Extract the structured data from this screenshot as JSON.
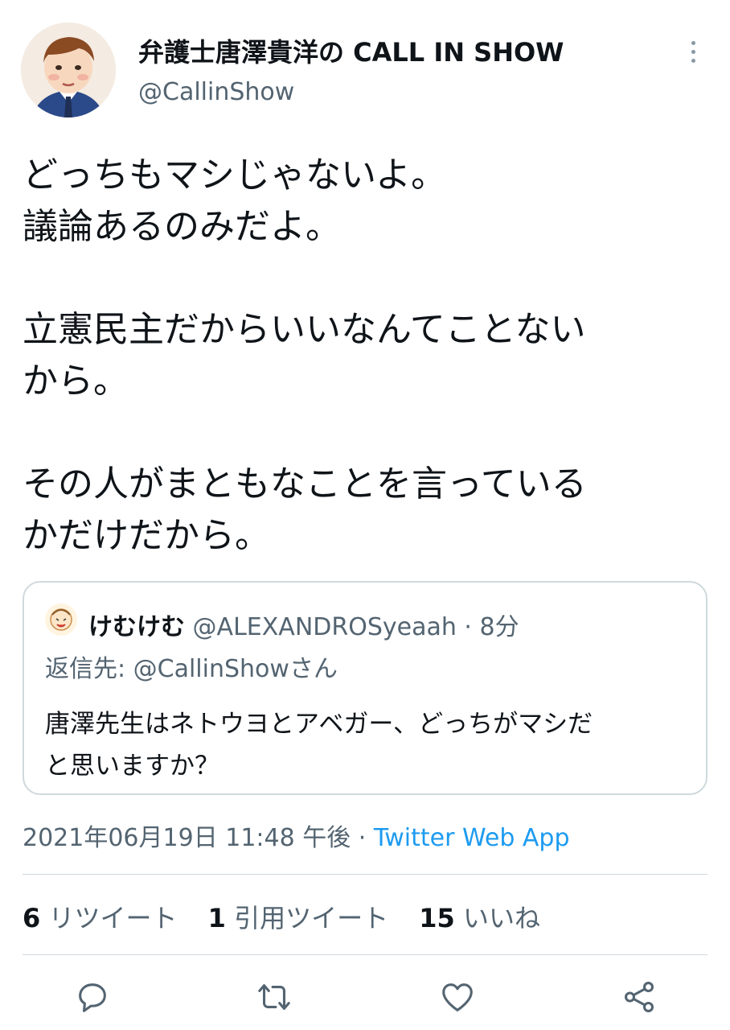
{
  "author": {
    "display_name": "弁護士唐澤貴洋の CALL IN SHOW",
    "handle": "@CallinShow"
  },
  "tweet": {
    "lines": [
      "どっちもマシじゃないよ。",
      "議論あるのみだよ。",
      "",
      "立憲民主だからいいなんてことない",
      "から。",
      "",
      "その人がまともなことを言っている",
      "かだけだから。"
    ]
  },
  "quoted": {
    "name": "けむけむ",
    "handle": "@ALEXANDROSyeaah",
    "separator": "·",
    "time": "8分",
    "reply_to": "返信先: @CallinShowさん",
    "lines": [
      "唐澤先生はネトウヨとアベガー、どっちがマシだ",
      "と思いますか？"
    ]
  },
  "meta": {
    "timestamp": "2021年06月19日 11:48 午後",
    "separator": "·",
    "app": "Twitter Web App"
  },
  "stats": {
    "retweets": {
      "count": "6",
      "label": "リツイート"
    },
    "quotes": {
      "count": "1",
      "label": "引用ツイート"
    },
    "likes": {
      "count": "15",
      "label": "いいね"
    }
  },
  "icons": {
    "reply": "reply-icon",
    "retweet": "retweet-icon",
    "like": "heart-icon",
    "share": "share-icon",
    "more": "more-dots-icon"
  },
  "colors": {
    "link": "#1d9bf0",
    "secondary_text": "#536471",
    "border": "#cfd9de"
  }
}
